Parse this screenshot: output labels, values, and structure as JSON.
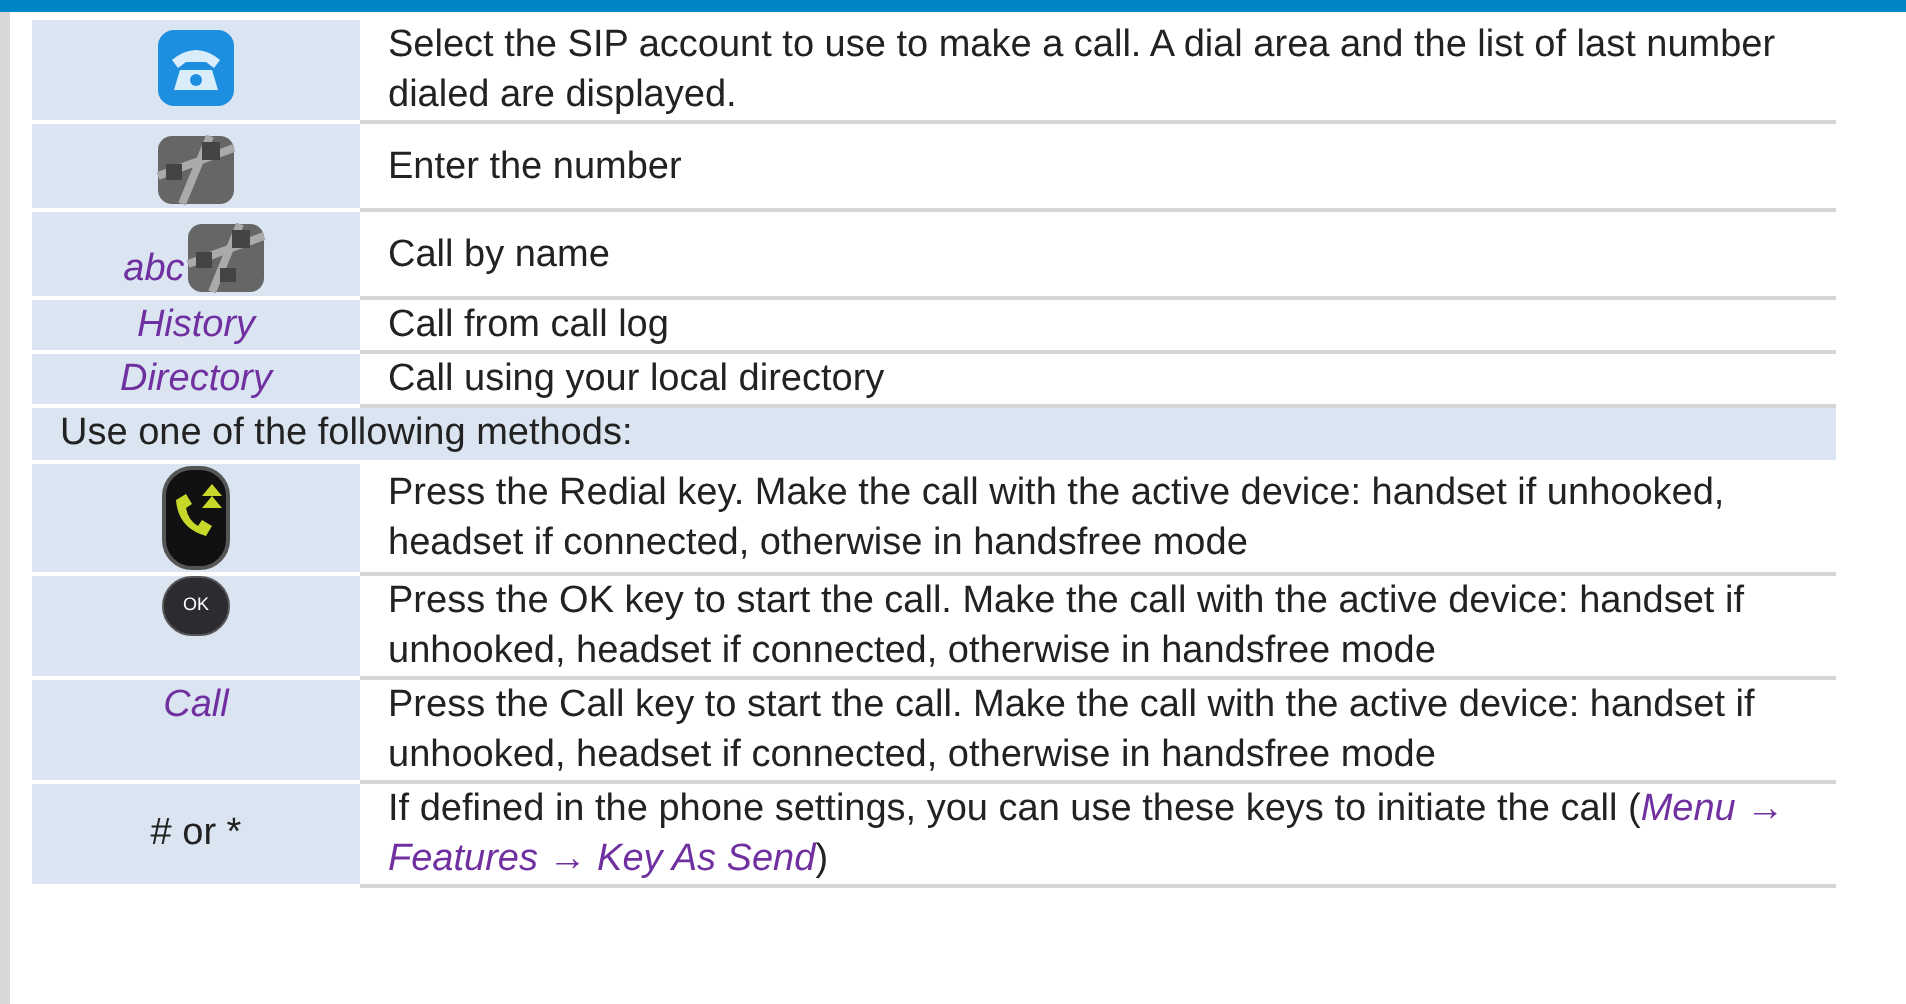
{
  "rows": [
    {
      "kind": "app",
      "description": "Select the SIP account to use to make a call. A dial area and the list of last number dialed are displayed."
    },
    {
      "kind": "keypad",
      "description": "Enter the number"
    },
    {
      "kind": "name",
      "label": "abc",
      "description": "Call by name"
    },
    {
      "kind": "softkey",
      "label": "History",
      "description": "Call from call log"
    },
    {
      "kind": "softkey",
      "label": "Directory",
      "description": "Call using your local directory"
    },
    {
      "kind": "heading",
      "description": "Use one of the following methods:"
    },
    {
      "kind": "redial",
      "description": "Press the Redial key. Make the call with the active device: handset if unhooked, headset if connected, otherwise in handsfree mode"
    },
    {
      "kind": "ok",
      "label": "OK",
      "description": "Press the OK key to start the call. Make the call with the active device: handset if unhooked, headset if connected, otherwise in handsfree mode"
    },
    {
      "kind": "softkey-top",
      "label": "Call",
      "description": "Press the Call key to start the call. Make the call with the active device: handset if unhooked, headset if connected, otherwise in handsfree mode"
    },
    {
      "kind": "plain",
      "label": "# or *",
      "description": "If defined in the phone settings, you can use these keys to initiate the call (*Menu → Features → Key As Send*)"
    }
  ]
}
